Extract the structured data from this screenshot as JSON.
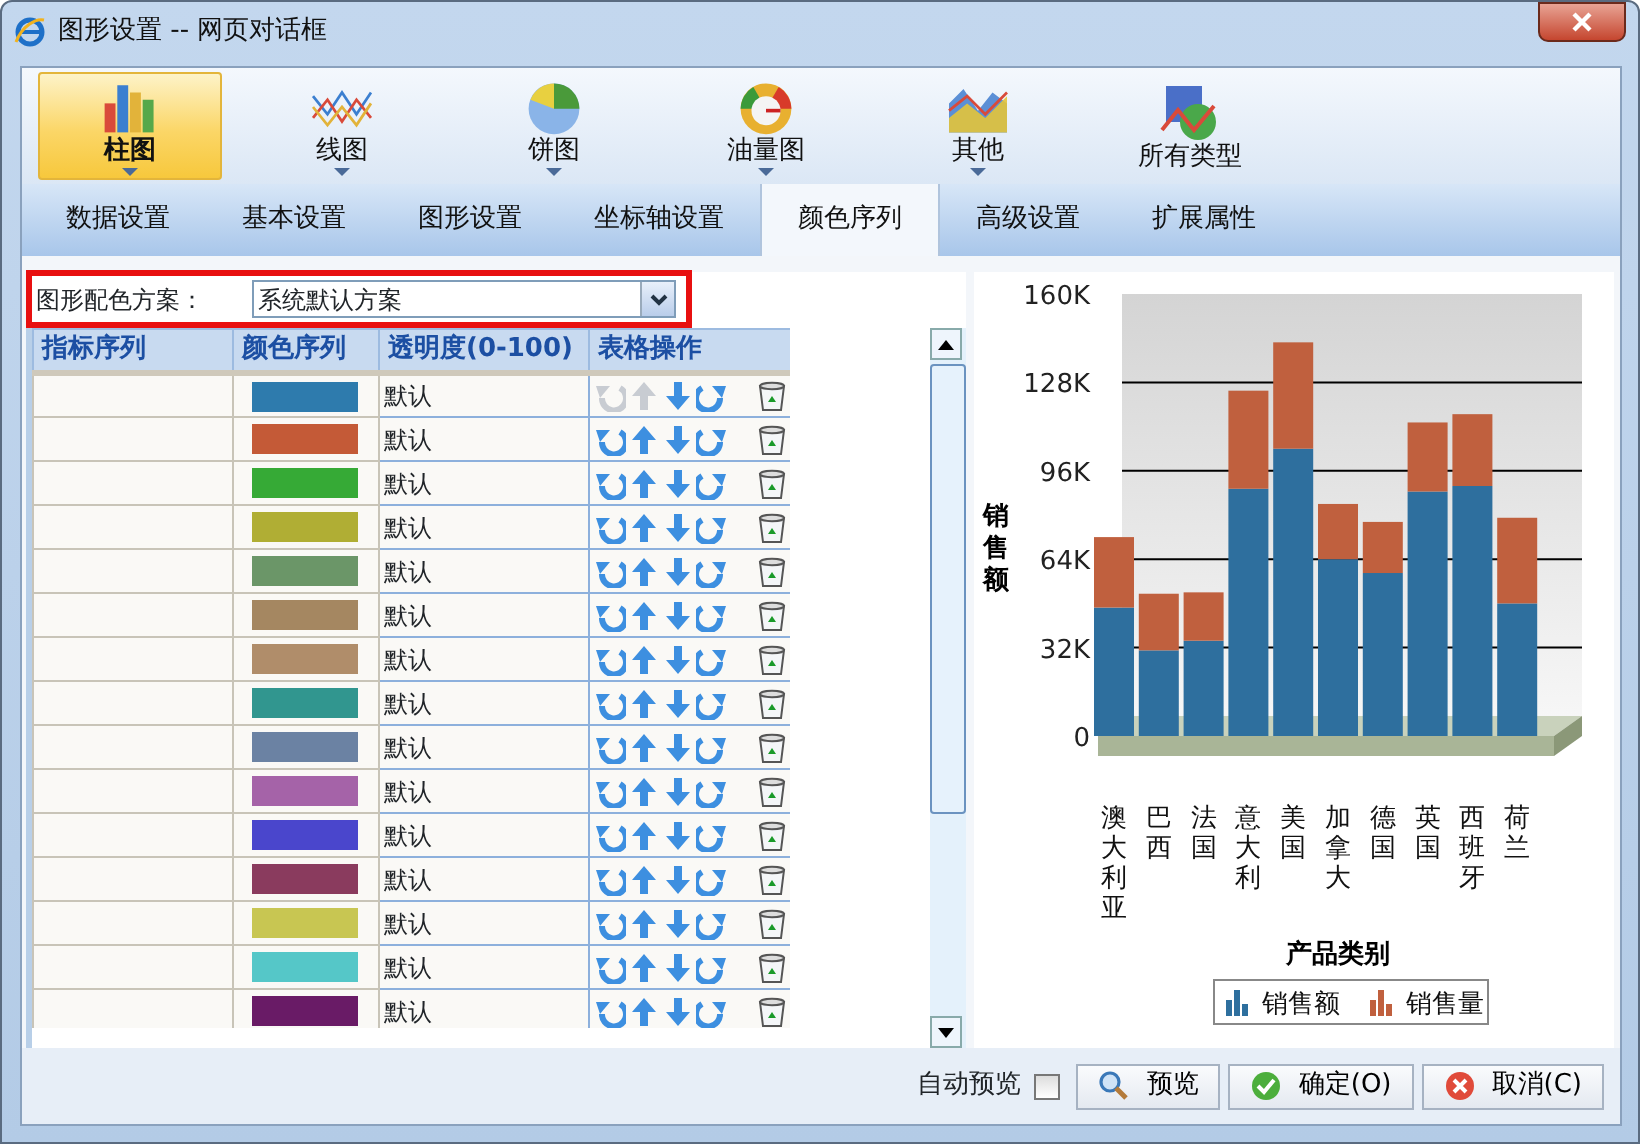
{
  "window": {
    "title": "图形设置 -- 网页对话框"
  },
  "chart_types": [
    {
      "label": "柱图",
      "kind": "bar",
      "selected": true,
      "dropdown": true
    },
    {
      "label": "线图",
      "kind": "line",
      "selected": false,
      "dropdown": true
    },
    {
      "label": "饼图",
      "kind": "pie",
      "selected": false,
      "dropdown": true
    },
    {
      "label": "油量图",
      "kind": "gauge",
      "selected": false,
      "dropdown": true
    },
    {
      "label": "其他",
      "kind": "area",
      "selected": false,
      "dropdown": true
    },
    {
      "label": "所有类型",
      "kind": "all",
      "selected": false,
      "dropdown": false
    }
  ],
  "tabs": [
    {
      "label": "数据设置",
      "selected": false
    },
    {
      "label": "基本设置",
      "selected": false
    },
    {
      "label": "图形设置",
      "selected": false
    },
    {
      "label": "坐标轴设置",
      "selected": false
    },
    {
      "label": "颜色序列",
      "selected": true
    },
    {
      "label": "高级设置",
      "selected": false
    },
    {
      "label": "扩展属性",
      "selected": false
    }
  ],
  "scheme": {
    "label": "图形配色方案：",
    "value": "系统默认方案"
  },
  "table": {
    "columns": [
      "指标序列",
      "颜色序列",
      "透明度(0-100)",
      "表格操作"
    ],
    "rows": [
      {
        "color": "#2e7bad",
        "opacity": "默认",
        "move_up_disabled": true
      },
      {
        "color": "#c45a37",
        "opacity": "默认",
        "move_up_disabled": false
      },
      {
        "color": "#36aa36",
        "opacity": "默认",
        "move_up_disabled": false
      },
      {
        "color": "#b0ae34",
        "opacity": "默认",
        "move_up_disabled": false
      },
      {
        "color": "#6b9668",
        "opacity": "默认",
        "move_up_disabled": false
      },
      {
        "color": "#a58761",
        "opacity": "默认",
        "move_up_disabled": false
      },
      {
        "color": "#b08d6a",
        "opacity": "默认",
        "move_up_disabled": false
      },
      {
        "color": "#31968f",
        "opacity": "默认",
        "move_up_disabled": false
      },
      {
        "color": "#6b82a3",
        "opacity": "默认",
        "move_up_disabled": false
      },
      {
        "color": "#a563a8",
        "opacity": "默认",
        "move_up_disabled": false
      },
      {
        "color": "#4a46cc",
        "opacity": "默认",
        "move_up_disabled": false
      },
      {
        "color": "#8a3b5e",
        "opacity": "默认",
        "move_up_disabled": false
      },
      {
        "color": "#c8c652",
        "opacity": "默认",
        "move_up_disabled": false
      },
      {
        "color": "#55c7c8",
        "opacity": "默认",
        "move_up_disabled": false
      },
      {
        "color": "#691b66",
        "opacity": "默认",
        "move_up_disabled": false
      }
    ]
  },
  "chart": {
    "chart_data": {
      "type": "bar",
      "stacked": true,
      "ylabel": "销售额",
      "xlabel": "产品类别",
      "categories": [
        "澳大利亚",
        "巴西",
        "法国",
        "意大利",
        "美国",
        "加拿大",
        "德国",
        "英国",
        "西班牙",
        "荷兰"
      ],
      "series": [
        {
          "name": "销售额",
          "color": "#2e6f9e",
          "values": [
            46500,
            31000,
            34500,
            89500,
            104000,
            64000,
            59000,
            88500,
            90500,
            48000
          ]
        },
        {
          "name": "销售量",
          "color": "#c0603e",
          "values": [
            25500,
            20500,
            17500,
            35500,
            38500,
            20000,
            18500,
            25000,
            26000,
            31000
          ]
        }
      ],
      "ylim": [
        0,
        160000
      ],
      "grid": true,
      "legend": true,
      "yticks": [
        {
          "value": 0,
          "label": "0"
        },
        {
          "value": 32000,
          "label": "32K"
        },
        {
          "value": 64000,
          "label": "64K"
        },
        {
          "value": 96000,
          "label": "96K"
        },
        {
          "value": 128000,
          "label": "128K"
        },
        {
          "value": 160000,
          "label": "160K"
        }
      ]
    }
  },
  "footer": {
    "auto_preview": {
      "label": "自动预览",
      "checked": false
    },
    "buttons": [
      {
        "label": "预览",
        "kind": "preview"
      },
      {
        "label": "确定(O)",
        "kind": "ok"
      },
      {
        "label": "取消(C)",
        "kind": "cancel"
      }
    ]
  }
}
